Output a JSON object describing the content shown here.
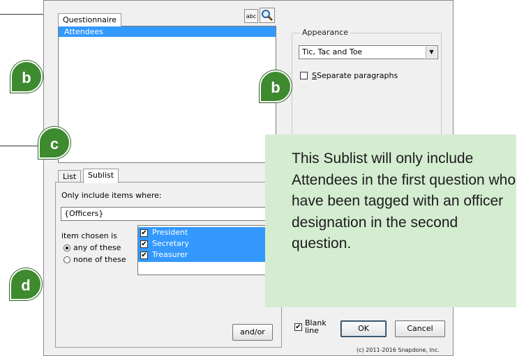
{
  "dialog": {
    "tab_questionnaire": "Questionnaire",
    "abc_label": "abc",
    "list_items": [
      "Attendees"
    ],
    "appearance": {
      "group_label": "Appearance",
      "selected": "Tic, Tac and Toe",
      "separate_paragraphs": "Separate paragraphs"
    },
    "lower_tabs": [
      "List",
      "Sublist"
    ],
    "only_include_label": "Only include items where:",
    "filter_value": "{Officers}",
    "item_chosen_is": "item chosen is",
    "radio_any": "any of these",
    "radio_none": "none of these",
    "officers": [
      "President",
      "Secretary",
      "Treasurer"
    ],
    "andor_button": "and/or",
    "blank_line_label": "Blank\nline",
    "ok_button": "OK",
    "cancel_button": "Cancel",
    "copyright": "(c) 2011-2016 Snapdone, Inc."
  },
  "callouts": {
    "b1": "b",
    "b2": "b",
    "c": "c",
    "d": "d"
  },
  "note_text": "This Sublist will only include Attendees in the first question who have been tagged with an officer designation in the second question."
}
